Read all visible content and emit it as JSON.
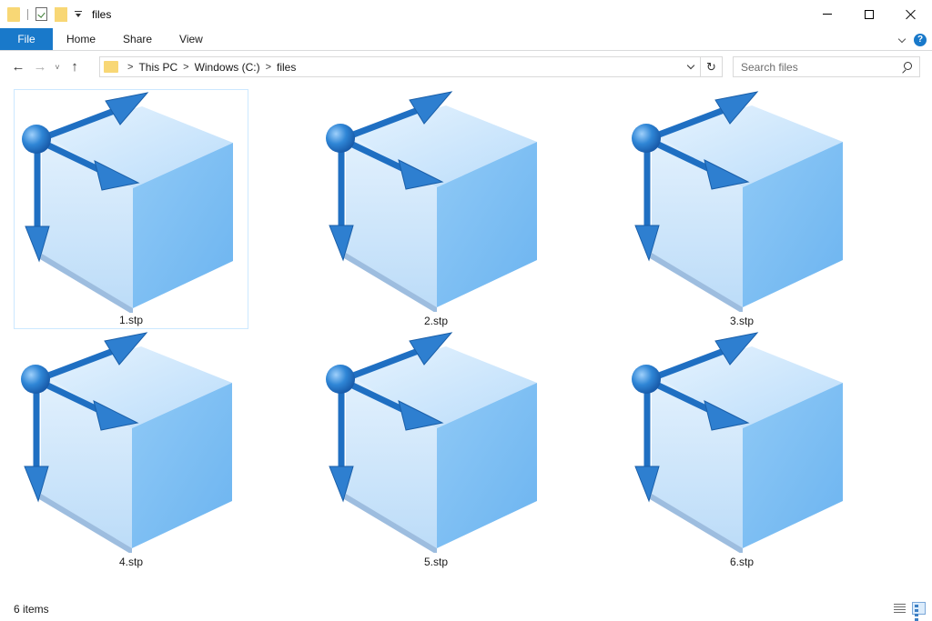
{
  "window": {
    "title": "files"
  },
  "ribbon": {
    "tabs": [
      "File",
      "Home",
      "Share",
      "View"
    ],
    "help_label": "?"
  },
  "nav": {
    "back_symbol": "←",
    "forward_symbol": "→",
    "recent_symbol": "˅",
    "up_symbol": "↑",
    "refresh_symbol": "↻"
  },
  "address": {
    "separator": ">",
    "breadcrumbs": [
      "This PC",
      "Windows (C:)",
      "files"
    ]
  },
  "search": {
    "placeholder": "Search files"
  },
  "files": [
    {
      "name": "1.stp",
      "selected": true
    },
    {
      "name": "2.stp",
      "selected": false
    },
    {
      "name": "3.stp",
      "selected": false
    },
    {
      "name": "4.stp",
      "selected": false
    },
    {
      "name": "5.stp",
      "selected": false
    },
    {
      "name": "6.stp",
      "selected": false
    }
  ],
  "status": {
    "item_count": "6 items"
  },
  "colors": {
    "accent": "#1979ca",
    "folder": "#f8d775",
    "cube_top": "#cfe6fb",
    "cube_left": "#a9d3f8",
    "cube_right": "#7fbff3",
    "arrow": "#1f6fc2"
  }
}
